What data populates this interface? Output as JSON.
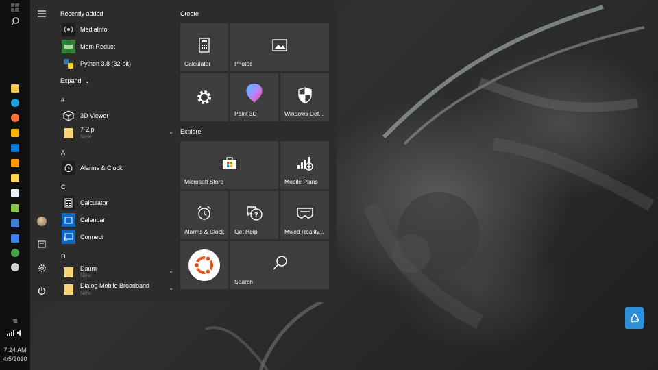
{
  "taskbar": {
    "clock_time": "7:24 AM",
    "clock_date": "4/5/2020",
    "pinned_icons": [
      "file-explorer-icon",
      "edge-icon",
      "firefox-icon",
      "store-icon",
      "mail-icon",
      "sublime-icon",
      "sticky-icon",
      "remote-icon",
      "lambda-icon",
      "outlook-icon",
      "app-icon",
      "xbox-icon",
      "settings-app-icon"
    ]
  },
  "start_menu": {
    "recently_added_title": "Recently added",
    "recent_apps": [
      {
        "name": "MediaInfo"
      },
      {
        "name": "Mem Reduct"
      },
      {
        "name": "Python 3.8 (32-bit)"
      }
    ],
    "expand_label": "Expand",
    "sections": [
      {
        "letter": "#",
        "apps": [
          {
            "name": "3D Viewer"
          },
          {
            "name": "7-Zip",
            "sub": "New"
          }
        ]
      },
      {
        "letter": "A",
        "apps": [
          {
            "name": "Alarms & Clock"
          }
        ]
      },
      {
        "letter": "C",
        "apps": [
          {
            "name": "Calculator"
          },
          {
            "name": "Calendar"
          },
          {
            "name": "Connect"
          }
        ]
      },
      {
        "letter": "D",
        "apps": [
          {
            "name": "Daum",
            "sub": "New"
          },
          {
            "name": "Dialog Mobile Broadband",
            "sub": "New"
          }
        ]
      }
    ],
    "groups": [
      {
        "title": "Create",
        "tiles": [
          {
            "label": "Calculator"
          },
          {
            "label": "Photos"
          },
          {
            "label": ""
          },
          {
            "label": "Paint 3D"
          },
          {
            "label": "Windows Def..."
          }
        ]
      },
      {
        "title": "Explore",
        "tiles": [
          {
            "label": "Microsoft Store"
          },
          {
            "label": "Mobile Plans"
          },
          {
            "label": "Alarms & Clock"
          },
          {
            "label": "Get Help"
          },
          {
            "label": "Mixed Reality..."
          },
          {
            "label": ""
          },
          {
            "label": "Search"
          }
        ]
      }
    ]
  },
  "colors": {
    "start_bg": "#2c2c2c",
    "tile_bg": "#3d3d3d",
    "taskbar_bg": "#101010",
    "accent_blue": "#2d8fd8",
    "ubuntu_orange": "#e95420"
  }
}
